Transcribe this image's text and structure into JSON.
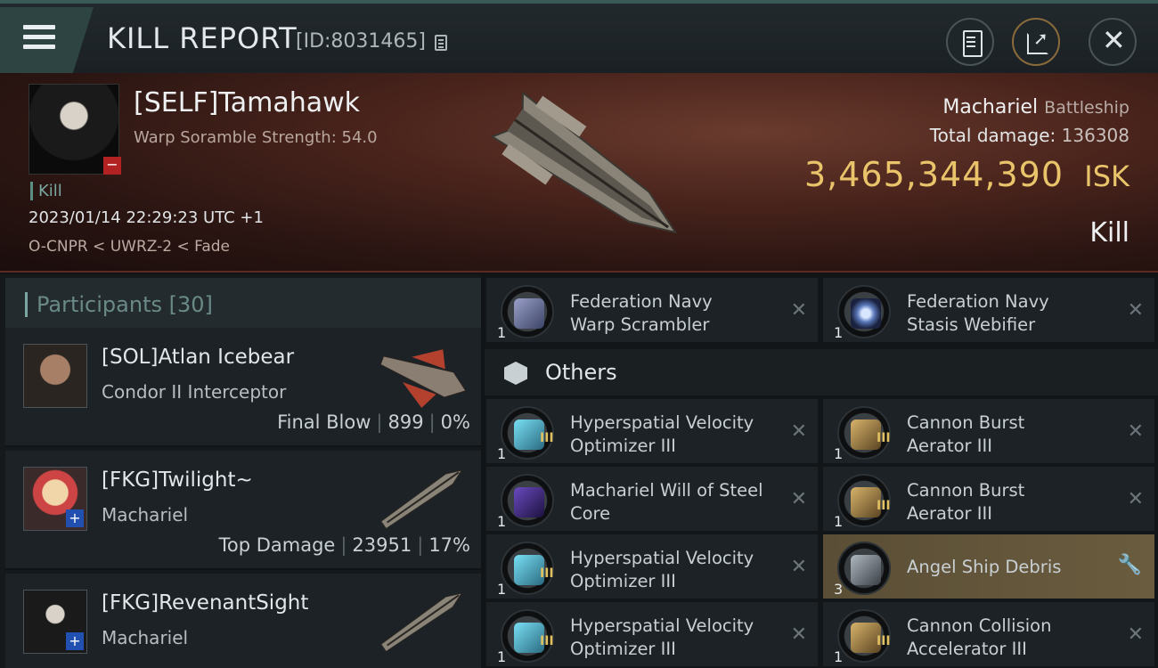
{
  "header": {
    "title": "KILL REPORT",
    "report_id": "[ID:8031465]",
    "icons": [
      "menu-icon",
      "copy-icon",
      "clipboard-icon",
      "share-icon",
      "close-icon"
    ]
  },
  "victim": {
    "name": "[SELF]Tamahawk",
    "subtitle": "Warp Soramble Strength: 54.0",
    "tag": "Kill",
    "datetime": "2023/01/14 22:29:23 UTC +1",
    "location": "O-CNPR < UWRZ-2 < Fade",
    "ship_name": "Machariel",
    "ship_class": "Battleship",
    "total_damage_label": "Total damage:",
    "total_damage": "136308",
    "isk_value": "3,465,344,390",
    "isk_unit": "ISK",
    "result": "Kill"
  },
  "participants": {
    "label": "Participants",
    "count": "[30]",
    "rows": [
      {
        "name": "[SOL]Atlan Icebear",
        "ship": "Condor II Interceptor",
        "role": "Final Blow",
        "damage": "899",
        "percent": "0%"
      },
      {
        "name": "[FKG]Twilight~",
        "ship": "Machariel",
        "role": "Top Damage",
        "damage": "23951",
        "percent": "17%"
      },
      {
        "name": "[FKG]RevenantSight",
        "ship": "Machariel",
        "role": "",
        "damage": "",
        "percent": ""
      }
    ]
  },
  "modules": {
    "others_label": "Others",
    "top": [
      {
        "line1": "Federation Navy",
        "line2": "Warp Scrambler",
        "qty": "1"
      },
      {
        "line1": "Federation Navy",
        "line2": "Stasis Webifier",
        "qty": "1"
      }
    ],
    "left": [
      {
        "line1": "Hyperspatial Velocity",
        "line2": "Optimizer III",
        "qty": "1",
        "tier": "III"
      },
      {
        "line1": "Machariel Will of Steel",
        "line2": "Core",
        "qty": "1",
        "tier": ""
      },
      {
        "line1": "Hyperspatial Velocity",
        "line2": "Optimizer III",
        "qty": "1",
        "tier": "III"
      },
      {
        "line1": "Hyperspatial Velocity",
        "line2": "Optimizer III",
        "qty": "1",
        "tier": "III"
      }
    ],
    "right": [
      {
        "line1": "Cannon Burst",
        "line2": "Aerator III",
        "qty": "1",
        "tier": "III"
      },
      {
        "line1": "Cannon Burst",
        "line2": "Aerator III",
        "qty": "1",
        "tier": "III"
      },
      {
        "line1": "Angel Ship Debris",
        "line2": "",
        "qty": "3",
        "tier": ""
      },
      {
        "line1": "Cannon Collision",
        "line2": "Accelerator III",
        "qty": "1",
        "tier": "III"
      }
    ],
    "close_glyph": "✕",
    "wrench_glyph": "🔧"
  },
  "colors": {
    "accent_gold": "#e9c46a",
    "teal": "#7aa6a2",
    "danger": "#b22222"
  }
}
